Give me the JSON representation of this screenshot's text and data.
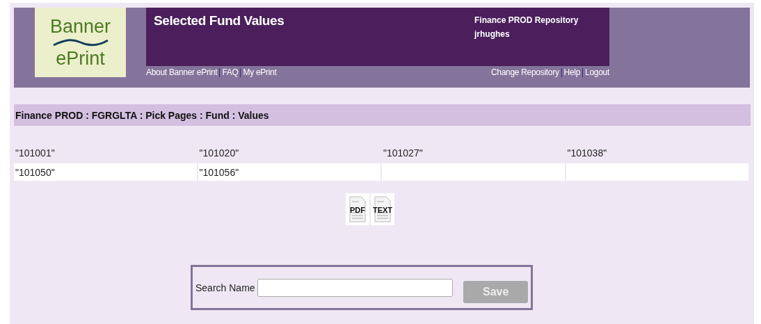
{
  "logo": {
    "line_1": "Banner",
    "line_2": "ePrint"
  },
  "header": {
    "title": "Selected Fund Values",
    "repository": "Finance PROD Repository",
    "user": "jrhughes"
  },
  "left_links": [
    "About Banner ePrint",
    "FAQ",
    "My ePrint"
  ],
  "right_links": [
    "Change Repository",
    "Help",
    "Logout"
  ],
  "breadcrumb": "Finance PROD : FGRGLTA : Pick Pages : Fund : Values",
  "values": [
    [
      "\"101001\"",
      "\"101020\"",
      "\"101027\"",
      "\"101038\""
    ],
    [
      "\"101050\"",
      "\"101056\""
    ]
  ],
  "exports": [
    "PDF",
    "TEXT"
  ],
  "search": {
    "label": "Search Name",
    "button": "Save",
    "button_disabled": true
  }
}
